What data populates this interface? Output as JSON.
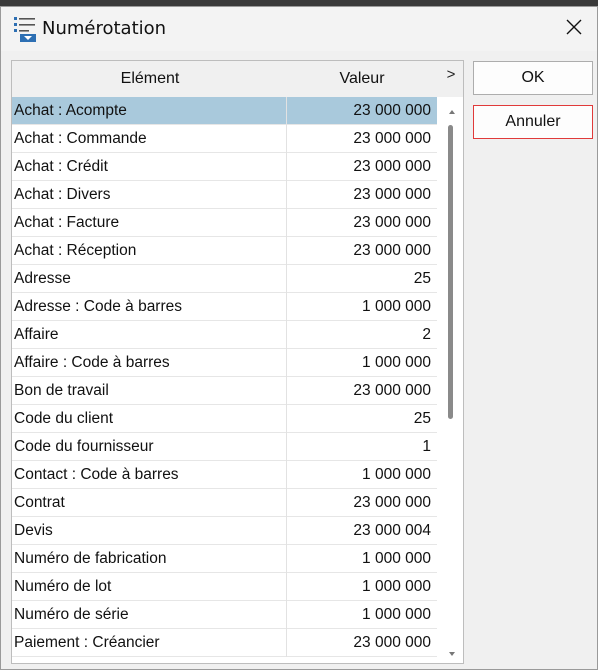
{
  "window": {
    "title": "Numérotation",
    "icon": "numbering-list-icon",
    "close_icon": "close-icon"
  },
  "table": {
    "columns": [
      "Elément",
      "Valeur"
    ],
    "more_indicator": ">",
    "selected_index": 0,
    "rows": [
      {
        "element": "Achat : Acompte",
        "value": "23 000 000"
      },
      {
        "element": "Achat : Commande",
        "value": "23 000 000"
      },
      {
        "element": "Achat : Crédit",
        "value": "23 000 000"
      },
      {
        "element": "Achat : Divers",
        "value": "23 000 000"
      },
      {
        "element": "Achat : Facture",
        "value": "23 000 000"
      },
      {
        "element": "Achat : Réception",
        "value": "23 000 000"
      },
      {
        "element": "Adresse",
        "value": "25"
      },
      {
        "element": "Adresse : Code à barres",
        "value": "1 000 000"
      },
      {
        "element": "Affaire",
        "value": "2"
      },
      {
        "element": "Affaire : Code à barres",
        "value": "1 000 000"
      },
      {
        "element": "Bon de travail",
        "value": "23 000 000"
      },
      {
        "element": "Code du client",
        "value": "25"
      },
      {
        "element": "Code du fournisseur",
        "value": "1"
      },
      {
        "element": "Contact : Code à barres",
        "value": "1 000 000"
      },
      {
        "element": "Contrat",
        "value": "23 000 000"
      },
      {
        "element": "Devis",
        "value": "23 000 004"
      },
      {
        "element": "Numéro de fabrication",
        "value": "1 000 000"
      },
      {
        "element": "Numéro de lot",
        "value": "1 000 000"
      },
      {
        "element": "Numéro de série",
        "value": "1 000 000"
      },
      {
        "element": "Paiement : Créancier",
        "value": "23 000 000"
      }
    ]
  },
  "buttons": {
    "ok_label": "OK",
    "cancel_label": "Annuler"
  },
  "colors": {
    "selection": "#a9c9dc",
    "cancel_border": "#e03a3a"
  }
}
